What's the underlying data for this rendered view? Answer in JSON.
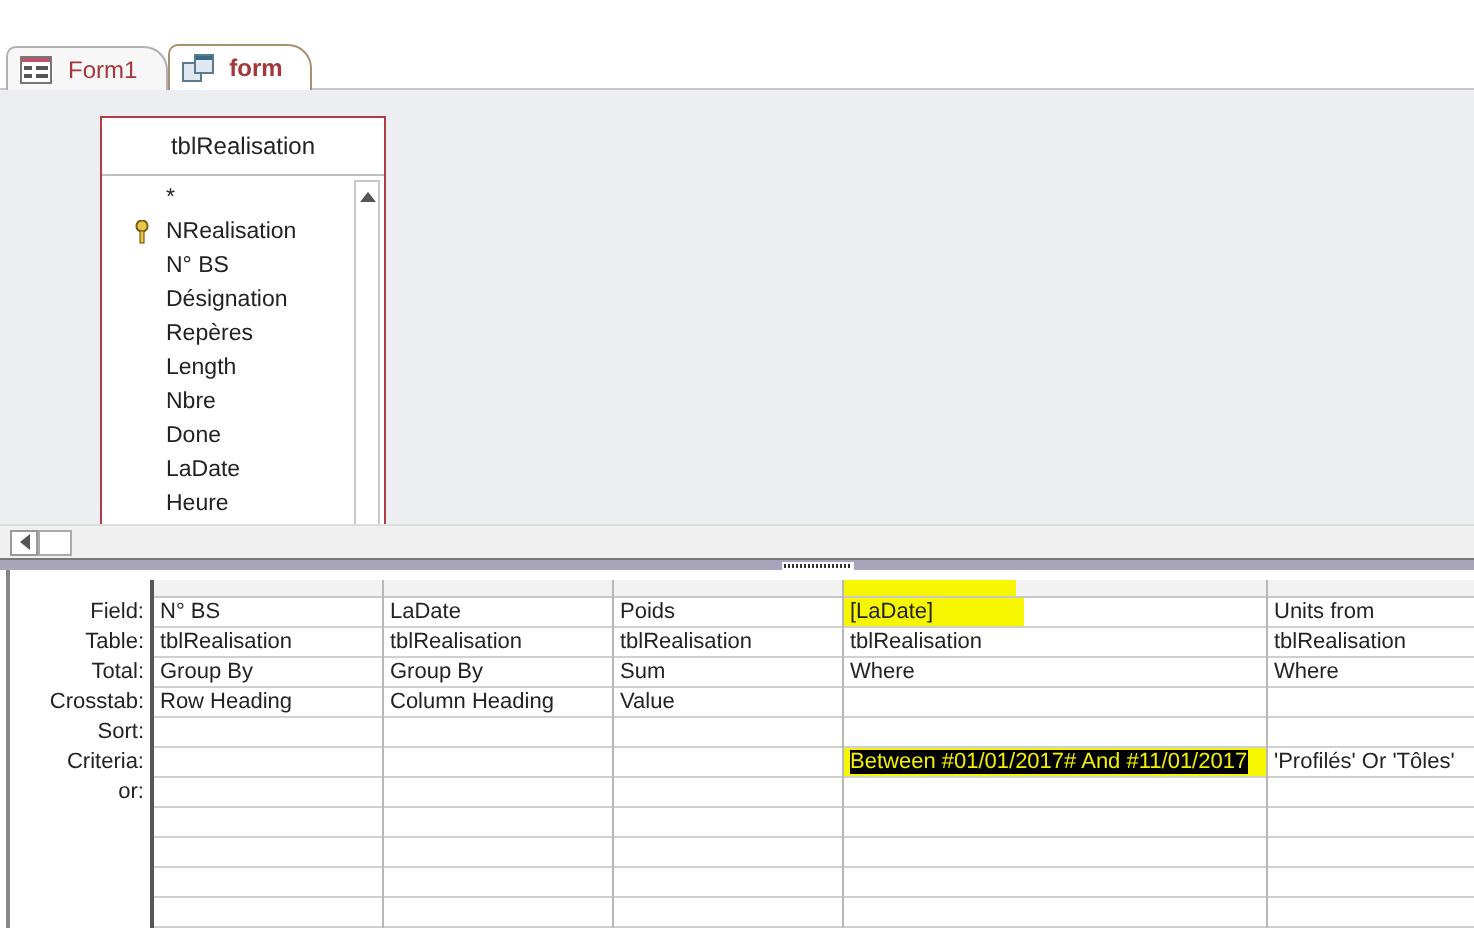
{
  "tabs": [
    {
      "label": "Form1",
      "kind": "form",
      "selected": false
    },
    {
      "label": "form",
      "kind": "query",
      "selected": true
    }
  ],
  "field_list": {
    "title": "tblRealisation",
    "items": [
      {
        "name": "*",
        "primary_key": false
      },
      {
        "name": "NRealisation",
        "primary_key": true
      },
      {
        "name": "N° BS",
        "primary_key": false
      },
      {
        "name": "Désignation",
        "primary_key": false
      },
      {
        "name": "Repères",
        "primary_key": false
      },
      {
        "name": "Length",
        "primary_key": false
      },
      {
        "name": "Nbre",
        "primary_key": false
      },
      {
        "name": "Done",
        "primary_key": false
      },
      {
        "name": "LaDate",
        "primary_key": false
      },
      {
        "name": "Heure",
        "primary_key": false
      }
    ]
  },
  "grid": {
    "row_labels": [
      "Field:",
      "Table:",
      "Total:",
      "Crosstab:",
      "Sort:",
      "Criteria:",
      "or:"
    ],
    "columns": [
      {
        "field": "N° BS",
        "table": "tblRealisation",
        "total": "Group By",
        "crosstab": "Row Heading",
        "field_highlighted": false,
        "criteria_highlighted": false
      },
      {
        "field": "LaDate",
        "table": "tblRealisation",
        "total": "Group By",
        "crosstab": "Column Heading",
        "field_highlighted": false,
        "criteria_highlighted": false
      },
      {
        "field": "Poids",
        "table": "tblRealisation",
        "total": "Sum",
        "crosstab": "Value",
        "field_highlighted": false,
        "criteria_highlighted": false
      },
      {
        "field": "[LaDate]",
        "table": "tblRealisation",
        "total": "Where",
        "criteria": "Between #01/01/2017# And #11/01/2017",
        "field_highlighted": true,
        "criteria_highlighted": true
      },
      {
        "field": "Units from",
        "table": "tblRealisation",
        "total": "Where",
        "criteria": "'Profilés' Or 'Tôles'",
        "field_highlighted": false,
        "criteria_highlighted": false
      }
    ]
  }
}
